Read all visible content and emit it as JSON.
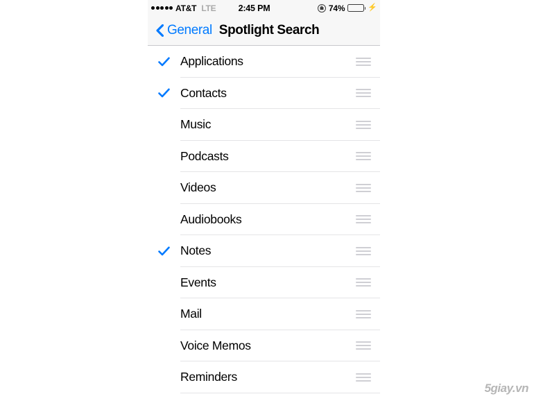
{
  "status_bar": {
    "signal_dots": 5,
    "carrier": "AT&T",
    "network": "LTE",
    "time": "2:45 PM",
    "battery_percent": "74%",
    "battery_level": 74,
    "battery_color": "#4CD964",
    "charging": true,
    "rotation_lock": true
  },
  "nav_bar": {
    "back_label": "General",
    "title": "Spotlight Search",
    "tint_color": "#017AFF"
  },
  "list": {
    "rows": [
      {
        "label": "Applications",
        "checked": true
      },
      {
        "label": "Contacts",
        "checked": true
      },
      {
        "label": "Music",
        "checked": false
      },
      {
        "label": "Podcasts",
        "checked": false
      },
      {
        "label": "Videos",
        "checked": false
      },
      {
        "label": "Audiobooks",
        "checked": false
      },
      {
        "label": "Notes",
        "checked": true
      },
      {
        "label": "Events",
        "checked": false
      },
      {
        "label": "Mail",
        "checked": false
      },
      {
        "label": "Voice Memos",
        "checked": false
      },
      {
        "label": "Reminders",
        "checked": false
      }
    ]
  },
  "watermark": {
    "text": "5giay.vn"
  }
}
